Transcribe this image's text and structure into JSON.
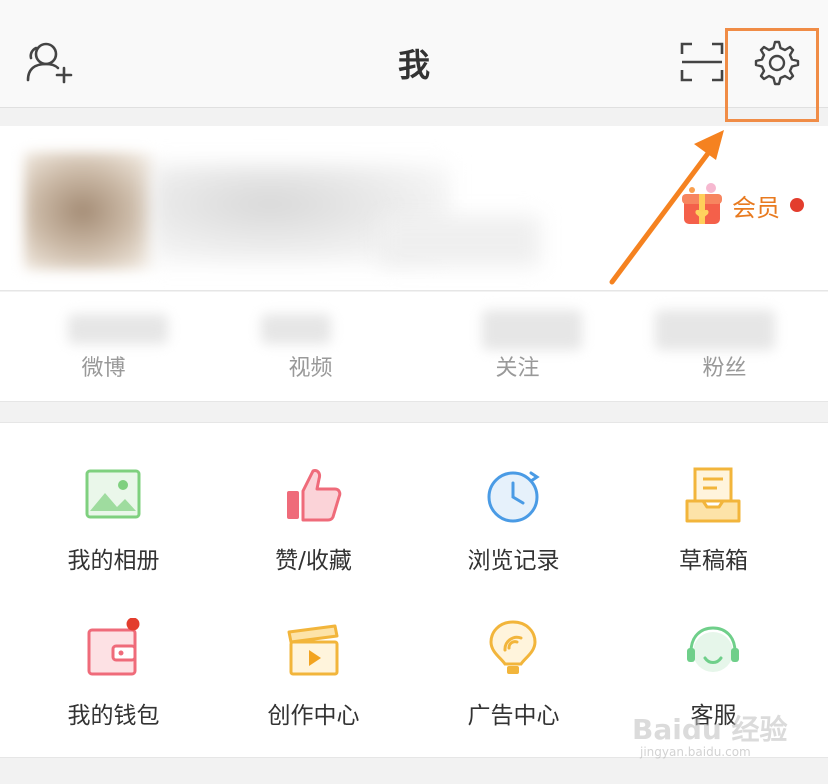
{
  "header": {
    "title": "我"
  },
  "profile": {
    "vip_label": "会员"
  },
  "stats": [
    {
      "label": "微博"
    },
    {
      "label": "视频"
    },
    {
      "label": "关注"
    },
    {
      "label": "粉丝"
    }
  ],
  "grid": [
    {
      "label": "我的相册",
      "icon": "photo-album-icon"
    },
    {
      "label": "赞/收藏",
      "icon": "thumbs-up-icon"
    },
    {
      "label": "浏览记录",
      "icon": "history-clock-icon"
    },
    {
      "label": "草稿箱",
      "icon": "drafts-tray-icon"
    },
    {
      "label": "我的钱包",
      "icon": "wallet-icon"
    },
    {
      "label": "创作中心",
      "icon": "clapperboard-icon"
    },
    {
      "label": "广告中心",
      "icon": "ad-bulb-icon"
    },
    {
      "label": "客服",
      "icon": "headset-icon"
    }
  ],
  "watermark": {
    "brand": "Baidu 经验",
    "site": "jingyan.baidu.com"
  },
  "colors": {
    "accent_orange": "#f08c46",
    "vip_orange": "#e87a1f",
    "badge_red": "#e33d2d"
  }
}
